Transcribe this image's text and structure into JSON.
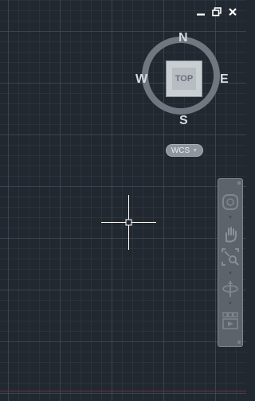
{
  "window": {
    "minimize_icon": "minimize-icon",
    "restore_icon": "restore-icon",
    "close_icon": "close-icon"
  },
  "viewcube": {
    "north": "N",
    "south": "S",
    "east": "E",
    "west": "W",
    "face_label": "TOP"
  },
  "wcs": {
    "label": "WCS",
    "dropdown_icon": "chevron-down-icon"
  },
  "navbar": {
    "tools": [
      "steering-wheel-icon",
      "pan-icon",
      "zoom-extents-icon",
      "orbit-icon",
      "showmotion-icon"
    ]
  },
  "colors": {
    "background": "#212830",
    "grid_major": "#465260",
    "grid_minor": "#303944",
    "axis_red": "#7a2f3a",
    "crosshair": "#ffffff"
  }
}
